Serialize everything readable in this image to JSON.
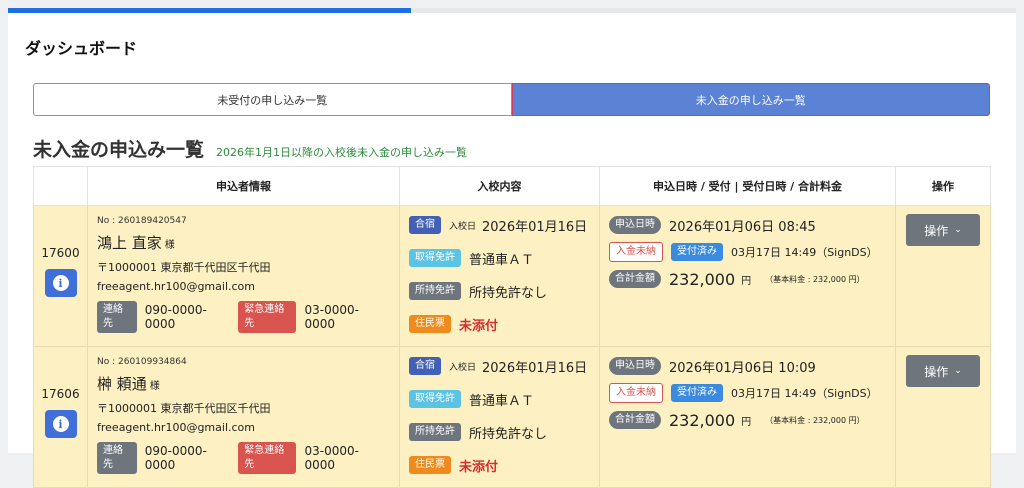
{
  "progress": {
    "fraction": 0.4
  },
  "page_title": "ダッシュボード",
  "tabs": [
    {
      "label": "未受付の申し込み一覧",
      "active": false
    },
    {
      "label": "未入金の申し込み一覧",
      "active": true
    }
  ],
  "section": {
    "title": "未入金の申込み一覧",
    "subtitle": "2026年1月1日以降の入校後未入金の申し込み一覧"
  },
  "table": {
    "headers": [
      "",
      "申込者情報",
      "入校内容",
      "申込日時 / 受付 | 受付日時 / 合計料金",
      "操作"
    ],
    "labels": {
      "phone": "連絡先",
      "emergency": "緊急連絡先",
      "stay": "合宿",
      "entry_date": "入校日",
      "license_target": "取得免許",
      "license_held": "所持免許",
      "residence": "住民票",
      "applied_at": "申込日時",
      "unpaid": "入金未納",
      "received": "受付済み",
      "total": "合計金額",
      "yen": "円",
      "ops": "操作"
    },
    "rows": [
      {
        "id": "17600",
        "app_no": "No : 260189420547",
        "name": "鴻上 直家",
        "sama": "様",
        "address": "〒1000001 東京都千代田区千代田",
        "email": "freeagent.hr100@gmail.com",
        "phone": "090-0000-0000",
        "emergency_phone": "03-0000-0000",
        "entry_date": "2026年01月16日",
        "license_target": "普通車ＡＴ",
        "license_held": "所持免許なし",
        "residence_status": "未添付",
        "applied_at": "2026年01月06日 08:45",
        "received_at": "03月17日 14:49（SignDS）",
        "total": "232,000",
        "base_fee": "（基本料金 : 232,000 円）"
      },
      {
        "id": "17606",
        "app_no": "No : 260109934864",
        "name": "榊 頼通",
        "sama": "様",
        "address": "〒1000001 東京都千代田区千代田",
        "email": "freeagent.hr100@gmail.com",
        "phone": "090-0000-0000",
        "emergency_phone": "03-0000-0000",
        "entry_date": "2026年01月16日",
        "license_target": "普通車ＡＴ",
        "license_held": "所持免許なし",
        "residence_status": "未添付",
        "applied_at": "2026年01月06日 10:09",
        "received_at": "03月17日 14:49（SignDS）",
        "total": "232,000",
        "base_fee": "（基本料金 : 232,000 円）"
      }
    ]
  }
}
